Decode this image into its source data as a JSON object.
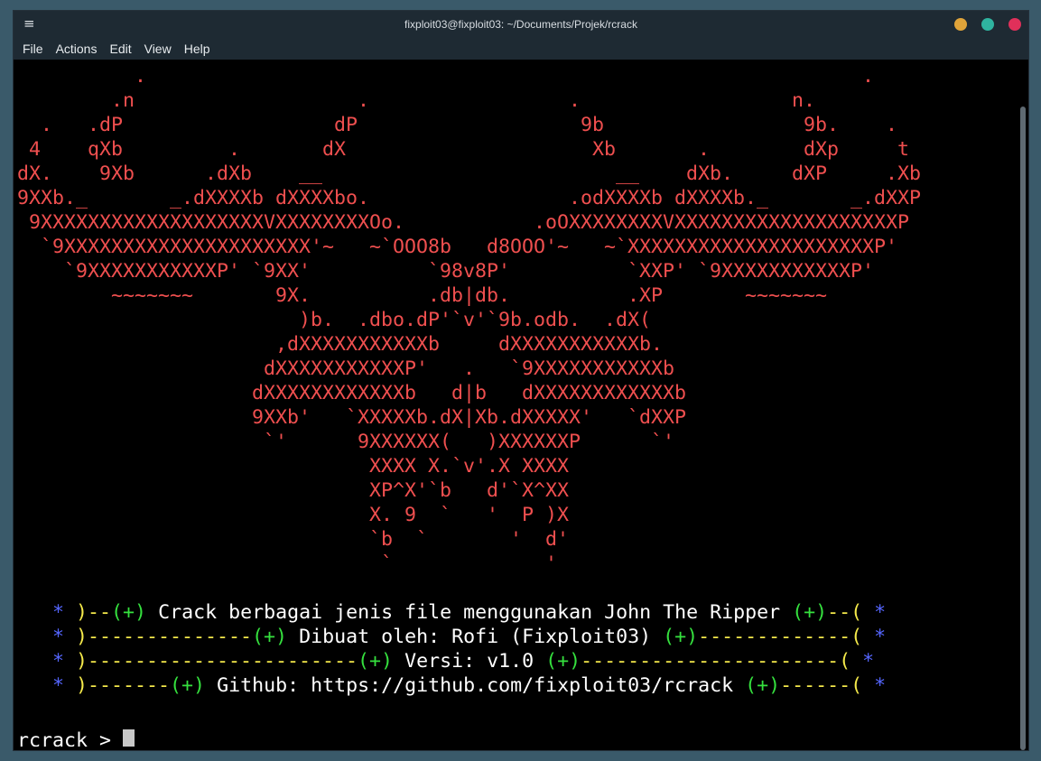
{
  "window": {
    "title": "fixploit03@fixploit03: ~/Documents/Projek/rcrack",
    "menu_icon": "≡",
    "controls": {
      "minimize_color": "#e0a43a",
      "maximize_color": "#2fb4a0",
      "close_color": "#e0305a"
    }
  },
  "menu": [
    "File",
    "Actions",
    "Edit",
    "View",
    "Help"
  ],
  "ascii_art": [
    "          .                                                             .",
    "        .n                   .                 .                  n.",
    "  .   .dP                  dP                   9b                 9b.    .",
    " 4    qXb         .       dX                     Xb       .        dXp     t",
    "dX.    9Xb      .dXb    __                         __    dXb.     dXP     .Xb",
    "9XXb._       _.dXXXXb dXXXXbo.                 .odXXXXb dXXXXb._       _.dXXP",
    " 9XXXXXXXXXXXXXXXXXXXVXXXXXXXXOo.           .oOXXXXXXXXVXXXXXXXXXXXXXXXXXXXP",
    "  `9XXXXXXXXXXXXXXXXXXXXX'~   ~`OOO8b   d8OOO'~   ~`XXXXXXXXXXXXXXXXXXXXXP'",
    "    `9XXXXXXXXXXXP' `9XX'          `98v8P'          `XXP' `9XXXXXXXXXXXP'",
    "        ~~~~~~~       9X.          .db|db.          .XP       ~~~~~~~",
    "                        )b.  .dbo.dP'`v'`9b.odb.  .dX(",
    "                      ,dXXXXXXXXXXXb     dXXXXXXXXXXXb.",
    "                     dXXXXXXXXXXXP'   .   `9XXXXXXXXXXXb",
    "                    dXXXXXXXXXXXXb   d|b   dXXXXXXXXXXXXb",
    "                    9XXb'   `XXXXXb.dX|Xb.dXXXXX'   `dXXP",
    "                     `'      9XXXXXX(   )XXXXXXP      `'",
    "                              XXXX X.`v'.X XXXX",
    "                              XP^X'`b   d'`X^XX",
    "                              X. 9  `   '  P )X",
    "                              `b  `       '  d'",
    "                               `             '"
  ],
  "banner": [
    {
      "star_l": "*",
      "left": ")--",
      "plus_l": "(+)",
      "text": " Crack berbagai jenis file menggunakan John The Ripper ",
      "plus_r": "(+)",
      "right": "--(",
      "star_r": "*"
    },
    {
      "star_l": "*",
      "left": ")--------------",
      "plus_l": "(+)",
      "text": " Dibuat oleh: Rofi (Fixploit03) ",
      "plus_r": "(+)",
      "right": "-------------(",
      "star_r": "*"
    },
    {
      "star_l": "*",
      "left": ")-----------------------",
      "plus_l": "(+)",
      "text": " Versi: v1.0 ",
      "plus_r": "(+)",
      "right": "----------------------(",
      "star_r": "*"
    },
    {
      "star_l": "*",
      "left": ")-------",
      "plus_l": "(+)",
      "text": " Github: https://github.com/fixploit03/rcrack ",
      "plus_r": "(+)",
      "right": "------(",
      "star_r": "*"
    }
  ],
  "prompt": {
    "label": "rcrack",
    "symbol": " > "
  }
}
